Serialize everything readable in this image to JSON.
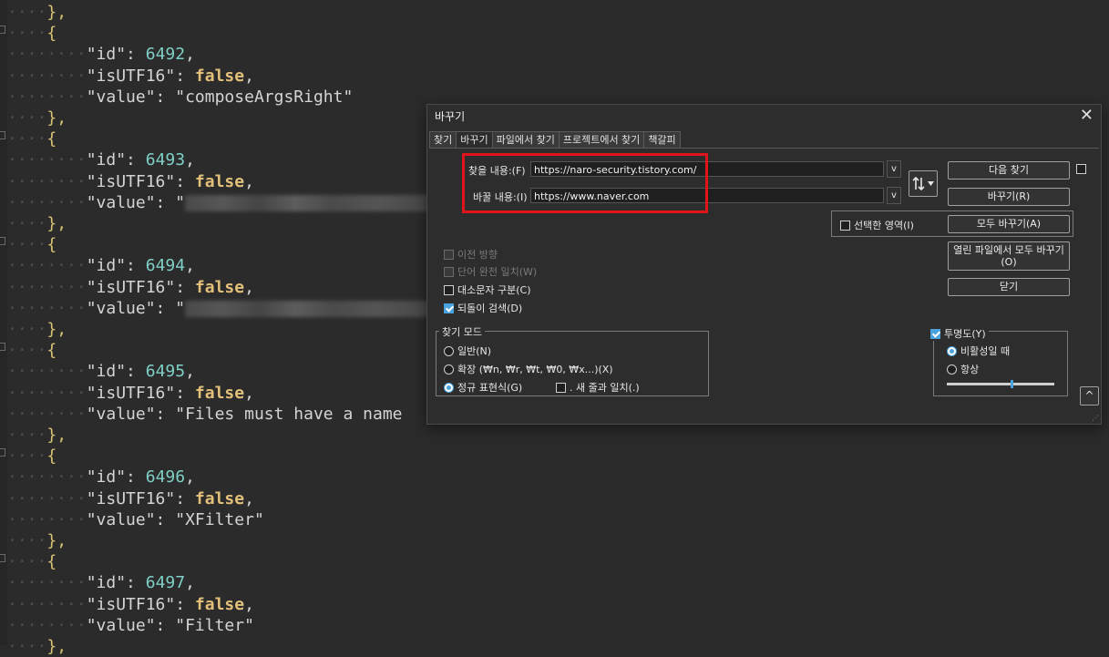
{
  "editor": {
    "lines": [
      {
        "indent": "····",
        "parts": [
          {
            "t": "},",
            "c": "brace"
          }
        ]
      },
      {
        "indent": "····",
        "parts": [
          {
            "t": "{",
            "c": "brace"
          }
        ]
      },
      {
        "indent": "········",
        "parts": [
          {
            "t": "\"id\": ",
            "c": "key"
          },
          {
            "t": "6492",
            "c": "num"
          },
          {
            "t": ",",
            "c": "key"
          }
        ]
      },
      {
        "indent": "········",
        "parts": [
          {
            "t": "\"isUTF16\": ",
            "c": "key"
          },
          {
            "t": "false",
            "c": "bool"
          },
          {
            "t": ",",
            "c": "key"
          }
        ]
      },
      {
        "indent": "········",
        "parts": [
          {
            "t": "\"value\": ",
            "c": "key"
          },
          {
            "t": "\"composeArgsRight\"",
            "c": "str"
          }
        ]
      },
      {
        "indent": "····",
        "parts": [
          {
            "t": "},",
            "c": "brace"
          }
        ]
      },
      {
        "indent": "····",
        "parts": [
          {
            "t": "{",
            "c": "brace"
          }
        ]
      },
      {
        "indent": "········",
        "parts": [
          {
            "t": "\"id\": ",
            "c": "key"
          },
          {
            "t": "6493",
            "c": "num"
          },
          {
            "t": ",",
            "c": "key"
          }
        ]
      },
      {
        "indent": "········",
        "parts": [
          {
            "t": "\"isUTF16\": ",
            "c": "key"
          },
          {
            "t": "false",
            "c": "bool"
          },
          {
            "t": ",",
            "c": "key"
          }
        ]
      },
      {
        "indent": "········",
        "parts": [
          {
            "t": "\"value\": \"",
            "c": "key"
          },
          {
            "blur": true
          }
        ]
      },
      {
        "indent": "····",
        "parts": [
          {
            "t": "},",
            "c": "brace"
          }
        ]
      },
      {
        "indent": "····",
        "parts": [
          {
            "t": "{",
            "c": "brace"
          }
        ]
      },
      {
        "indent": "········",
        "parts": [
          {
            "t": "\"id\": ",
            "c": "key"
          },
          {
            "t": "6494",
            "c": "num"
          },
          {
            "t": ",",
            "c": "key"
          }
        ]
      },
      {
        "indent": "········",
        "parts": [
          {
            "t": "\"isUTF16\": ",
            "c": "key"
          },
          {
            "t": "false",
            "c": "bool"
          },
          {
            "t": ",",
            "c": "key"
          }
        ]
      },
      {
        "indent": "········",
        "parts": [
          {
            "t": "\"value\": \"",
            "c": "key"
          },
          {
            "blur": true
          }
        ]
      },
      {
        "indent": "····",
        "parts": [
          {
            "t": "},",
            "c": "brace"
          }
        ]
      },
      {
        "indent": "····",
        "parts": [
          {
            "t": "{",
            "c": "brace"
          }
        ]
      },
      {
        "indent": "········",
        "parts": [
          {
            "t": "\"id\": ",
            "c": "key"
          },
          {
            "t": "6495",
            "c": "num"
          },
          {
            "t": ",",
            "c": "key"
          }
        ]
      },
      {
        "indent": "········",
        "parts": [
          {
            "t": "\"isUTF16\": ",
            "c": "key"
          },
          {
            "t": "false",
            "c": "bool"
          },
          {
            "t": ",",
            "c": "key"
          }
        ]
      },
      {
        "indent": "········",
        "parts": [
          {
            "t": "\"value\": ",
            "c": "key"
          },
          {
            "t": "\"Files must have a name",
            "c": "str"
          }
        ]
      },
      {
        "indent": "····",
        "parts": [
          {
            "t": "},",
            "c": "brace"
          }
        ]
      },
      {
        "indent": "····",
        "parts": [
          {
            "t": "{",
            "c": "brace"
          }
        ]
      },
      {
        "indent": "········",
        "parts": [
          {
            "t": "\"id\": ",
            "c": "key"
          },
          {
            "t": "6496",
            "c": "num"
          },
          {
            "t": ",",
            "c": "key"
          }
        ]
      },
      {
        "indent": "········",
        "parts": [
          {
            "t": "\"isUTF16\": ",
            "c": "key"
          },
          {
            "t": "false",
            "c": "bool"
          },
          {
            "t": ",",
            "c": "key"
          }
        ]
      },
      {
        "indent": "········",
        "parts": [
          {
            "t": "\"value\": ",
            "c": "key"
          },
          {
            "t": "\"XFilter\"",
            "c": "str"
          }
        ]
      },
      {
        "indent": "····",
        "parts": [
          {
            "t": "},",
            "c": "brace"
          }
        ]
      },
      {
        "indent": "····",
        "parts": [
          {
            "t": "{",
            "c": "brace"
          }
        ]
      },
      {
        "indent": "········",
        "parts": [
          {
            "t": "\"id\": ",
            "c": "key"
          },
          {
            "t": "6497",
            "c": "num"
          },
          {
            "t": ",",
            "c": "key"
          }
        ]
      },
      {
        "indent": "········",
        "parts": [
          {
            "t": "\"isUTF16\": ",
            "c": "key"
          },
          {
            "t": "false",
            "c": "bool"
          },
          {
            "t": ",",
            "c": "key"
          }
        ]
      },
      {
        "indent": "········",
        "parts": [
          {
            "t": "\"value\": ",
            "c": "key"
          },
          {
            "t": "\"Filter\"",
            "c": "str"
          }
        ]
      },
      {
        "indent": "····",
        "parts": [
          {
            "t": "},",
            "c": "brace"
          }
        ]
      }
    ]
  },
  "dialog": {
    "title": "바꾸기",
    "close_glyph": "✕",
    "tabs": [
      "찾기",
      "바꾸기",
      "파일에서 찾기",
      "프로젝트에서 찾기",
      "책갈피"
    ],
    "find_label": "찾을 내용:(F)",
    "find_value": "https://naro-security.tistory.com/",
    "replace_label": "바꿀 내용:(I)",
    "replace_value": "https://www.naver.com",
    "dropdown_glyph": "v",
    "buttons": {
      "find_next": "다음 찾기",
      "replace": "바꾸기(R)",
      "replace_all": "모두 바꾸기(A)",
      "replace_all_open_line1": "열린 파일에서 모두 바꾸기",
      "replace_all_open_line2": "(O)",
      "close": "닫기"
    },
    "in_selection": "선택한 영역(I)",
    "options": {
      "backward": "이전 방향",
      "whole_word": "단어 완전 일치(W)",
      "match_case": "대소문자 구분(C)",
      "wrap_around": "되돌이 검색(D)"
    },
    "search_mode": {
      "legend": "찾기 모드",
      "normal": "일반(N)",
      "extended": "확장 (₩n, ₩r, ₩t, ₩0, ₩x...)(X)",
      "regex": "정규 표현식(G)",
      "dot_newline": ". 새 줄과 일치(.)"
    },
    "transparency": {
      "legend": "투명도(Y)",
      "on_losing_focus": "비활성일 때",
      "always": "항상",
      "level": 0.6
    },
    "collapse_glyph": "^",
    "accent_color": "#4aa3df",
    "highlight_color": "#e0141b"
  }
}
